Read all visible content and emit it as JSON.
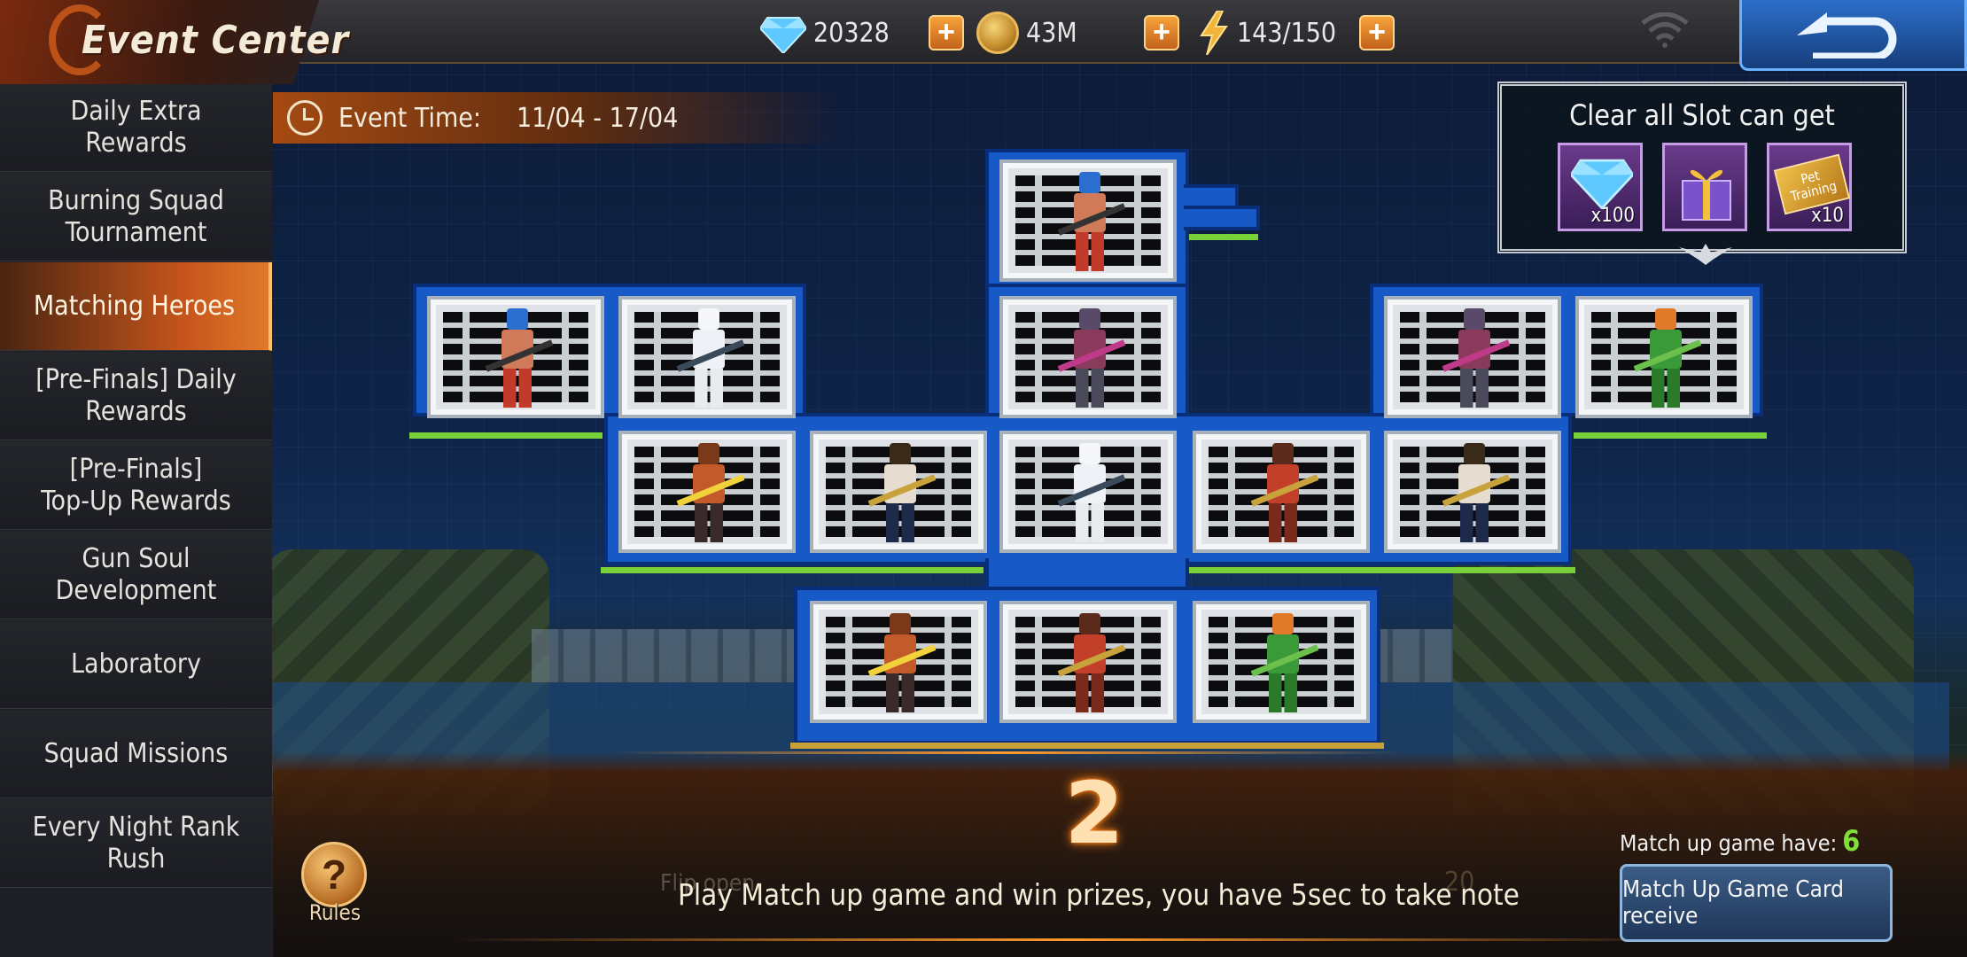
{
  "header": {
    "title": "Event Center",
    "resources": [
      {
        "name": "diamonds",
        "icon": "diamond-icon",
        "value": "20328"
      },
      {
        "name": "gold",
        "icon": "gold-coin-icon",
        "value": "43M"
      },
      {
        "name": "stamina",
        "icon": "lightning-icon",
        "value": "143/150"
      }
    ],
    "plus_label": "+"
  },
  "sidebar": {
    "items": [
      {
        "label": "Daily Extra\nRewards",
        "active": false
      },
      {
        "label": "Burning Squad\nTournament",
        "active": false
      },
      {
        "label": "Matching Heroes",
        "active": true
      },
      {
        "label": "[Pre-Finals] Daily\nRewards",
        "active": false
      },
      {
        "label": "[Pre-Finals]\nTop-Up Rewards",
        "active": false
      },
      {
        "label": "Gun Soul\nDevelopment",
        "active": false
      },
      {
        "label": "Laboratory",
        "active": false
      },
      {
        "label": "Squad Missions",
        "active": false
      },
      {
        "label": "Every Night Rank\nRush",
        "active": false
      }
    ]
  },
  "event": {
    "time_label": "Event Time:",
    "dates": "11/04 - 17/04"
  },
  "reward_box": {
    "title": "Clear all Slot can get",
    "rewards": [
      {
        "icon": "diamond-icon",
        "qty": "x100"
      },
      {
        "icon": "gift-box-icon",
        "qty": ""
      },
      {
        "icon": "pet-training-card-icon",
        "qty": "x10",
        "card_text": "Pet\nTraining"
      }
    ]
  },
  "board": {
    "cards": [
      {
        "hero": "blue-hair-gunner"
      },
      {
        "hero": "blue-hair-gunner"
      },
      {
        "hero": "polar-bear-sniper"
      },
      {
        "hero": "mecha-samurai"
      },
      {
        "hero": "mecha-samurai"
      },
      {
        "hero": "green-armor-girl"
      },
      {
        "hero": "sword-girl"
      },
      {
        "hero": "commando"
      },
      {
        "hero": "polar-bear-sniper"
      },
      {
        "hero": "fairy-rifle-girl"
      },
      {
        "hero": "commando"
      },
      {
        "hero": "sword-girl"
      },
      {
        "hero": "fairy-rifle-girl"
      },
      {
        "hero": "green-armor-girl"
      }
    ]
  },
  "bottom": {
    "countdown": "2",
    "instruction": "Play Match up game and win prizes, you have 5sec to take note",
    "ghost_text": "Flip open",
    "ghost_number": "20",
    "rules_label": "Rules",
    "rules_glyph": "?",
    "match_label": "Match up game have:",
    "match_count": "6",
    "receive_button": "Match Up Game Card receive"
  },
  "colors": {
    "accent_orange": "#c8561c",
    "board_blue": "#1759c7",
    "highlight_green": "#79d13a"
  }
}
